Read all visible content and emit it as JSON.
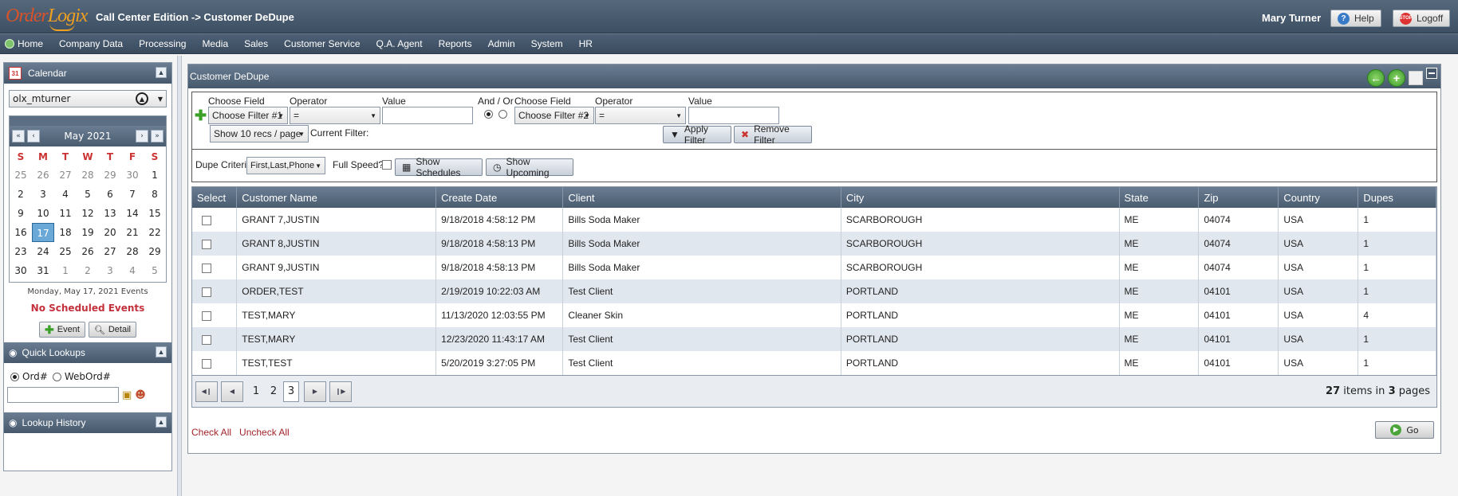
{
  "app": {
    "logo": {
      "part1": "Order",
      "part2": "Logix"
    },
    "title": "Call Center Edition -> Customer DeDupe",
    "user": "Mary Turner",
    "help_label": "Help",
    "logoff_label": "Logoff"
  },
  "menu": [
    "Home",
    "Company Data",
    "Processing",
    "Media",
    "Sales",
    "Customer Service",
    "Q.A. Agent",
    "Reports",
    "Admin",
    "System",
    "HR"
  ],
  "calendar": {
    "header": "Calendar",
    "user_select": "olx_mturner",
    "month": "May 2021",
    "weekdays": [
      "S",
      "M",
      "T",
      "W",
      "T",
      "F",
      "S"
    ],
    "weeks": [
      [
        "25",
        "26",
        "27",
        "28",
        "29",
        "30",
        "1"
      ],
      [
        "2",
        "3",
        "4",
        "5",
        "6",
        "7",
        "8"
      ],
      [
        "9",
        "10",
        "11",
        "12",
        "13",
        "14",
        "15"
      ],
      [
        "16",
        "17",
        "18",
        "19",
        "20",
        "21",
        "22"
      ],
      [
        "23",
        "24",
        "25",
        "26",
        "27",
        "28",
        "29"
      ],
      [
        "30",
        "31",
        "1",
        "2",
        "3",
        "4",
        "5"
      ]
    ],
    "today": "17",
    "events_date": "Monday, May 17, 2021 Events",
    "no_events": "No Scheduled Events",
    "event_button": "Event",
    "detail_button": "Detail"
  },
  "quick_lookups": {
    "header": "Quick Lookups",
    "option_ord": "Ord#",
    "option_webord": "WebOrd#",
    "selected": "Ord#"
  },
  "lookup_history": {
    "header": "Lookup History"
  },
  "main": {
    "title": "Customer DeDupe",
    "filter": {
      "choose_field_label": "Choose Field",
      "operator_label": "Operator",
      "value_label": "Value",
      "and_or_label": "And / Or",
      "filter1": "Choose Filter #1",
      "filter2": "Choose Filter #2",
      "operator1": "=",
      "operator2": "=",
      "value1": "",
      "value2": "",
      "recs_per_page": "Show 10 recs / page",
      "current_filter_label": "Current Filter:",
      "apply_label": "Apply Filter",
      "remove_label": "Remove Filter"
    },
    "dupe": {
      "criteria_label": "Dupe Criteria",
      "criteria_value": "First,Last,Phone",
      "full_speed_label": "Full Speed?",
      "show_schedules": "Show Schedules",
      "show_upcoming": "Show Upcoming"
    },
    "table": {
      "columns": [
        "Select",
        "Customer Name",
        "Create Date",
        "Client",
        "City",
        "State",
        "Zip",
        "Country",
        "Dupes"
      ],
      "rows": [
        [
          "GRANT 7,JUSTIN",
          "9/18/2018 4:58:12 PM",
          "Bills Soda Maker",
          "SCARBOROUGH",
          "ME",
          "04074",
          "USA",
          "1"
        ],
        [
          "GRANT 8,JUSTIN",
          "9/18/2018 4:58:13 PM",
          "Bills Soda Maker",
          "SCARBOROUGH",
          "ME",
          "04074",
          "USA",
          "1"
        ],
        [
          "GRANT 9,JUSTIN",
          "9/18/2018 4:58:13 PM",
          "Bills Soda Maker",
          "SCARBOROUGH",
          "ME",
          "04074",
          "USA",
          "1"
        ],
        [
          "ORDER,TEST",
          "2/19/2019 10:22:03 AM",
          "Test Client",
          "PORTLAND",
          "ME",
          "04101",
          "USA",
          "1"
        ],
        [
          "TEST,MARY",
          "11/13/2020 12:03:55 PM",
          "Cleaner Skin",
          "PORTLAND",
          "ME",
          "04101",
          "USA",
          "4"
        ],
        [
          "TEST,MARY",
          "12/23/2020 11:43:17 AM",
          "Test Client",
          "PORTLAND",
          "ME",
          "04101",
          "USA",
          "1"
        ],
        [
          "TEST,TEST",
          "5/20/2019 3:27:05 PM",
          "Test Client",
          "PORTLAND",
          "ME",
          "04101",
          "USA",
          "1"
        ]
      ]
    },
    "pager": {
      "pages": [
        "1",
        "2",
        "3"
      ],
      "current": "3",
      "items_count": "27",
      "items_text": "items in",
      "pages_count": "3",
      "pages_text": "pages"
    },
    "check_all": "Check All",
    "uncheck_all": "Uncheck All",
    "go_label": "Go"
  }
}
